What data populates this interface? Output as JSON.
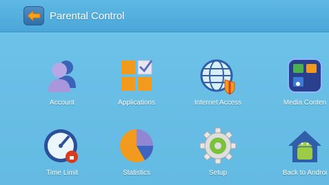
{
  "header": {
    "title": "Parental Control",
    "back_icon": "back-arrow-icon"
  },
  "grid": {
    "items": [
      {
        "label": "Account",
        "icon": "account-icon"
      },
      {
        "label": "Applications",
        "icon": "applications-icon"
      },
      {
        "label": "Internet Access",
        "icon": "internet-access-icon"
      },
      {
        "label": "Media Conten",
        "icon": "media-content-icon"
      },
      {
        "label": "Time Limit",
        "icon": "time-limit-icon"
      },
      {
        "label": "Statistics",
        "icon": "statistics-icon"
      },
      {
        "label": "Setup",
        "icon": "setup-icon"
      },
      {
        "label": "Back to Androi",
        "icon": "back-to-android-icon"
      }
    ]
  },
  "colors": {
    "background": "#69bfe6",
    "titlebar": "#4aa7d9",
    "accent_orange": "#f29a1e"
  }
}
